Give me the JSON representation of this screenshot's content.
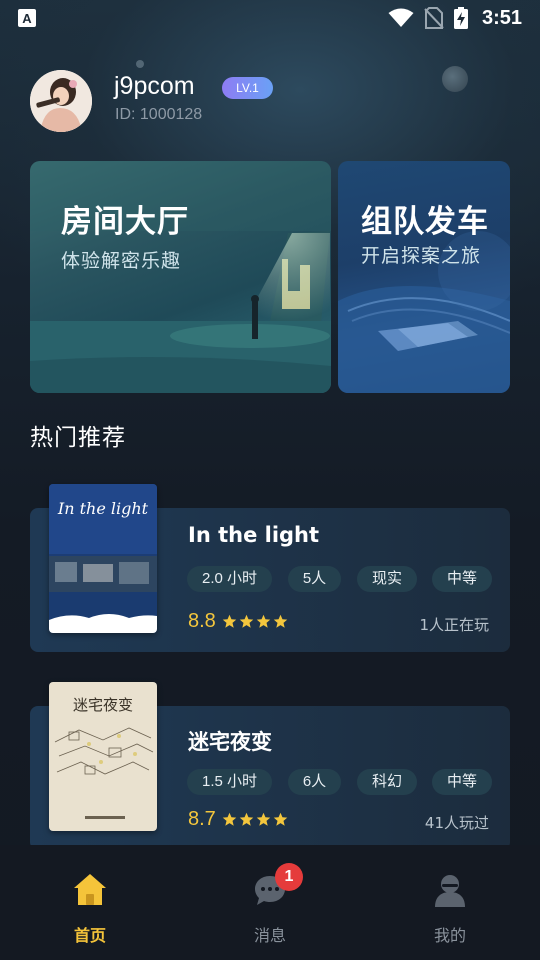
{
  "status_bar": {
    "time": "3:51",
    "icons": [
      "app-a-icon",
      "wifi-icon",
      "no-sim-icon",
      "battery-charging-icon"
    ]
  },
  "profile": {
    "username": "j9pcom",
    "level": "LV.1",
    "user_id": "ID: 1000128"
  },
  "features": [
    {
      "title": "房间大厅",
      "subtitle": "体验解密乐趣"
    },
    {
      "title": "组队发车",
      "subtitle": "开启探案之旅"
    }
  ],
  "section_title": "热门推荐",
  "games": [
    {
      "title": "In the light",
      "cover_text": "In the light",
      "tags": [
        "2.0 小时",
        "5人",
        "现实",
        "中等"
      ],
      "rating": "8.8",
      "stars": 4,
      "players": "1人正在玩"
    },
    {
      "title": "迷宅夜变",
      "cover_text": "迷宅夜变",
      "tags": [
        "1.5 小时",
        "6人",
        "科幻",
        "中等"
      ],
      "rating": "8.7",
      "stars": 4,
      "players": "41人玩过"
    }
  ],
  "nav": {
    "items": [
      {
        "label": "首页",
        "icon": "home-icon",
        "active": true
      },
      {
        "label": "消息",
        "icon": "chat-icon",
        "active": false
      },
      {
        "label": "我的",
        "icon": "user-icon",
        "active": false
      }
    ],
    "message_badge": "1"
  },
  "colors": {
    "accent_yellow": "#f3c63d",
    "badge_red": "#e53b3b",
    "tag_bg": "#24404e"
  }
}
